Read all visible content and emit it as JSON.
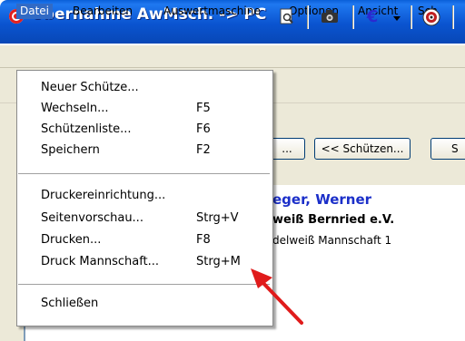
{
  "window": {
    "title": "Übernahme AwMsch. -> PC"
  },
  "menubar": {
    "items": [
      "Datei",
      "Bearbeiten",
      "Auswertmaschine",
      "Optionen",
      "Ansicht",
      "Sch"
    ]
  },
  "toolbar": {
    "icons": [
      "print-preview-icon",
      "camera-icon",
      "euro-icon",
      "dropdown-arrow-icon",
      "target-icon"
    ],
    "euro_symbol": "€"
  },
  "buttons": {
    "prev_dots": "...",
    "prev_schuetzen": "<< Schützen...",
    "next_partial": "S"
  },
  "content": {
    "name": "eger, Werner",
    "club": "weiß Bernried e.V.",
    "team": "delweiß Mannschaft 1"
  },
  "file_menu": {
    "groups": [
      [
        {
          "label": "Neuer Schütze...",
          "shortcut": ""
        },
        {
          "label": "Wechseln...",
          "shortcut": "F5"
        },
        {
          "label": "Schützenliste...",
          "shortcut": "F6"
        },
        {
          "label": "Speichern",
          "shortcut": "F2"
        }
      ],
      [
        {
          "label": "Druckereinrichtung...",
          "shortcut": ""
        },
        {
          "label": "Seitenvorschau...",
          "shortcut": "Strg+V"
        },
        {
          "label": "Drucken...",
          "shortcut": "F8"
        },
        {
          "label": "Druck Mannschaft...",
          "shortcut": "Strg+M"
        }
      ],
      [
        {
          "label": "Schließen",
          "shortcut": ""
        }
      ]
    ]
  },
  "colors": {
    "titlebar": "#0a54d0",
    "menu_highlight": "#316ac5",
    "name_text": "#1b2fc9",
    "annotation_arrow": "#e01b1b"
  }
}
